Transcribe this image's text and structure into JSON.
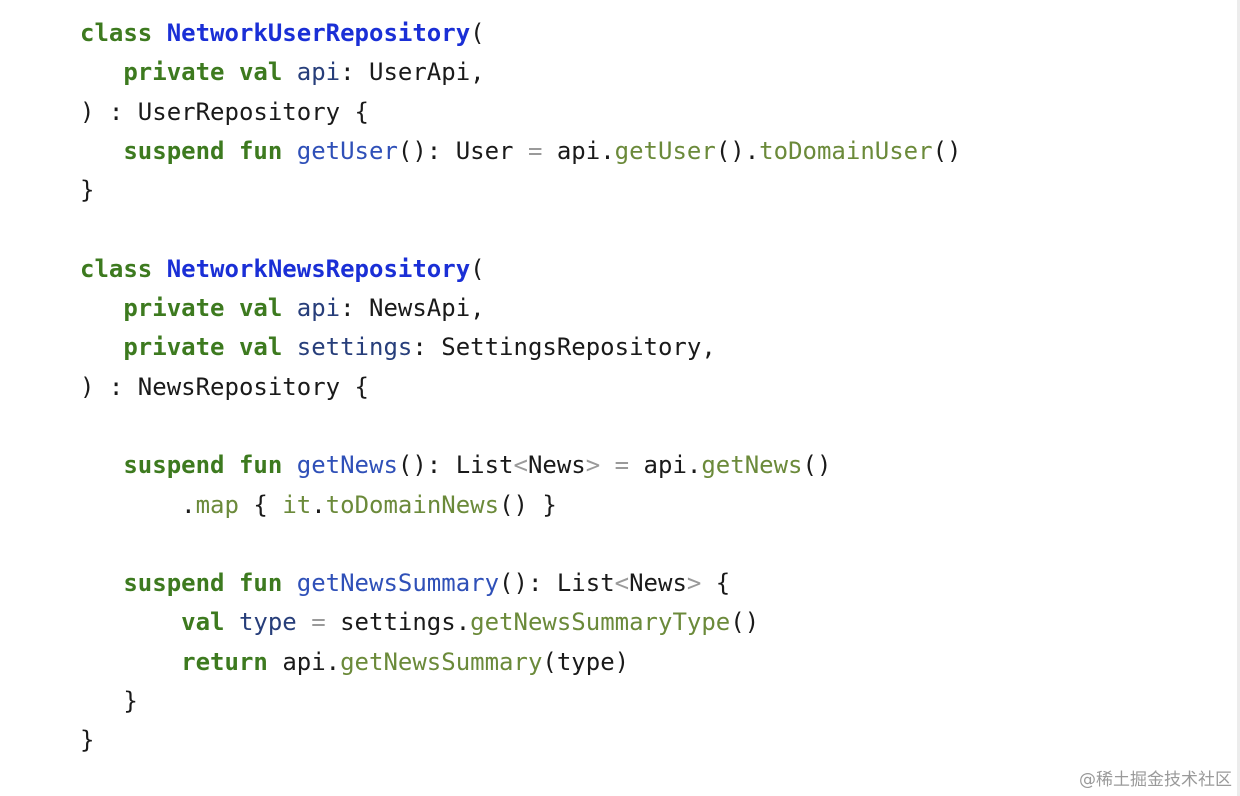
{
  "code": {
    "language": "kotlin",
    "lines": [
      [
        {
          "t": "kw",
          "v": "class "
        },
        {
          "t": "class",
          "v": "NetworkUserRepository"
        },
        {
          "t": "plain",
          "v": "("
        }
      ],
      [
        {
          "t": "plain",
          "v": "   "
        },
        {
          "t": "kw",
          "v": "private val "
        },
        {
          "t": "prop",
          "v": "api"
        },
        {
          "t": "plain",
          "v": ": UserApi,"
        }
      ],
      [
        {
          "t": "plain",
          "v": ") : UserRepository {"
        }
      ],
      [
        {
          "t": "plain",
          "v": "   "
        },
        {
          "t": "kw",
          "v": "suspend fun "
        },
        {
          "t": "fn",
          "v": "getUser"
        },
        {
          "t": "plain",
          "v": "(): User "
        },
        {
          "t": "op",
          "v": "="
        },
        {
          "t": "plain",
          "v": " api."
        },
        {
          "t": "call",
          "v": "getUser"
        },
        {
          "t": "plain",
          "v": "()."
        },
        {
          "t": "call",
          "v": "toDomainUser"
        },
        {
          "t": "plain",
          "v": "()"
        }
      ],
      [
        {
          "t": "plain",
          "v": "}"
        }
      ],
      [],
      [
        {
          "t": "kw",
          "v": "class "
        },
        {
          "t": "class",
          "v": "NetworkNewsRepository"
        },
        {
          "t": "plain",
          "v": "("
        }
      ],
      [
        {
          "t": "plain",
          "v": "   "
        },
        {
          "t": "kw",
          "v": "private val "
        },
        {
          "t": "prop",
          "v": "api"
        },
        {
          "t": "plain",
          "v": ": NewsApi,"
        }
      ],
      [
        {
          "t": "plain",
          "v": "   "
        },
        {
          "t": "kw",
          "v": "private val "
        },
        {
          "t": "prop",
          "v": "settings"
        },
        {
          "t": "plain",
          "v": ": SettingsRepository,"
        }
      ],
      [
        {
          "t": "plain",
          "v": ") : NewsRepository {"
        }
      ],
      [],
      [
        {
          "t": "plain",
          "v": "   "
        },
        {
          "t": "kw",
          "v": "suspend fun "
        },
        {
          "t": "fn",
          "v": "getNews"
        },
        {
          "t": "plain",
          "v": "(): List"
        },
        {
          "t": "op",
          "v": "<"
        },
        {
          "t": "plain",
          "v": "News"
        },
        {
          "t": "op",
          "v": ">"
        },
        {
          "t": "plain",
          "v": " "
        },
        {
          "t": "op",
          "v": "="
        },
        {
          "t": "plain",
          "v": " api."
        },
        {
          "t": "call",
          "v": "getNews"
        },
        {
          "t": "plain",
          "v": "()"
        }
      ],
      [
        {
          "t": "plain",
          "v": "       ."
        },
        {
          "t": "call",
          "v": "map"
        },
        {
          "t": "plain",
          "v": " { "
        },
        {
          "t": "call",
          "v": "it"
        },
        {
          "t": "plain",
          "v": "."
        },
        {
          "t": "call",
          "v": "toDomainNews"
        },
        {
          "t": "plain",
          "v": "() }"
        }
      ],
      [],
      [
        {
          "t": "plain",
          "v": "   "
        },
        {
          "t": "kw",
          "v": "suspend fun "
        },
        {
          "t": "fn",
          "v": "getNewsSummary"
        },
        {
          "t": "plain",
          "v": "(): List"
        },
        {
          "t": "op",
          "v": "<"
        },
        {
          "t": "plain",
          "v": "News"
        },
        {
          "t": "op",
          "v": ">"
        },
        {
          "t": "plain",
          "v": " {"
        }
      ],
      [
        {
          "t": "plain",
          "v": "       "
        },
        {
          "t": "kw",
          "v": "val "
        },
        {
          "t": "prop",
          "v": "type"
        },
        {
          "t": "plain",
          "v": " "
        },
        {
          "t": "op",
          "v": "="
        },
        {
          "t": "plain",
          "v": " settings."
        },
        {
          "t": "call",
          "v": "getNewsSummaryType"
        },
        {
          "t": "plain",
          "v": "()"
        }
      ],
      [
        {
          "t": "plain",
          "v": "       "
        },
        {
          "t": "kw",
          "v": "return "
        },
        {
          "t": "plain",
          "v": "api."
        },
        {
          "t": "call",
          "v": "getNewsSummary"
        },
        {
          "t": "plain",
          "v": "(type)"
        }
      ],
      [
        {
          "t": "plain",
          "v": "   }"
        }
      ],
      [
        {
          "t": "plain",
          "v": "}"
        }
      ]
    ]
  },
  "watermark": {
    "text": "@稀土掘金技术社区"
  },
  "colors": {
    "keyword": "#3d7a1f",
    "class_name": "#1a2fd6",
    "function_name": "#2f50b8",
    "property": "#273e7a",
    "call": "#6b8a3a",
    "operator": "#9a9a9a",
    "text": "#1a1a1a"
  }
}
